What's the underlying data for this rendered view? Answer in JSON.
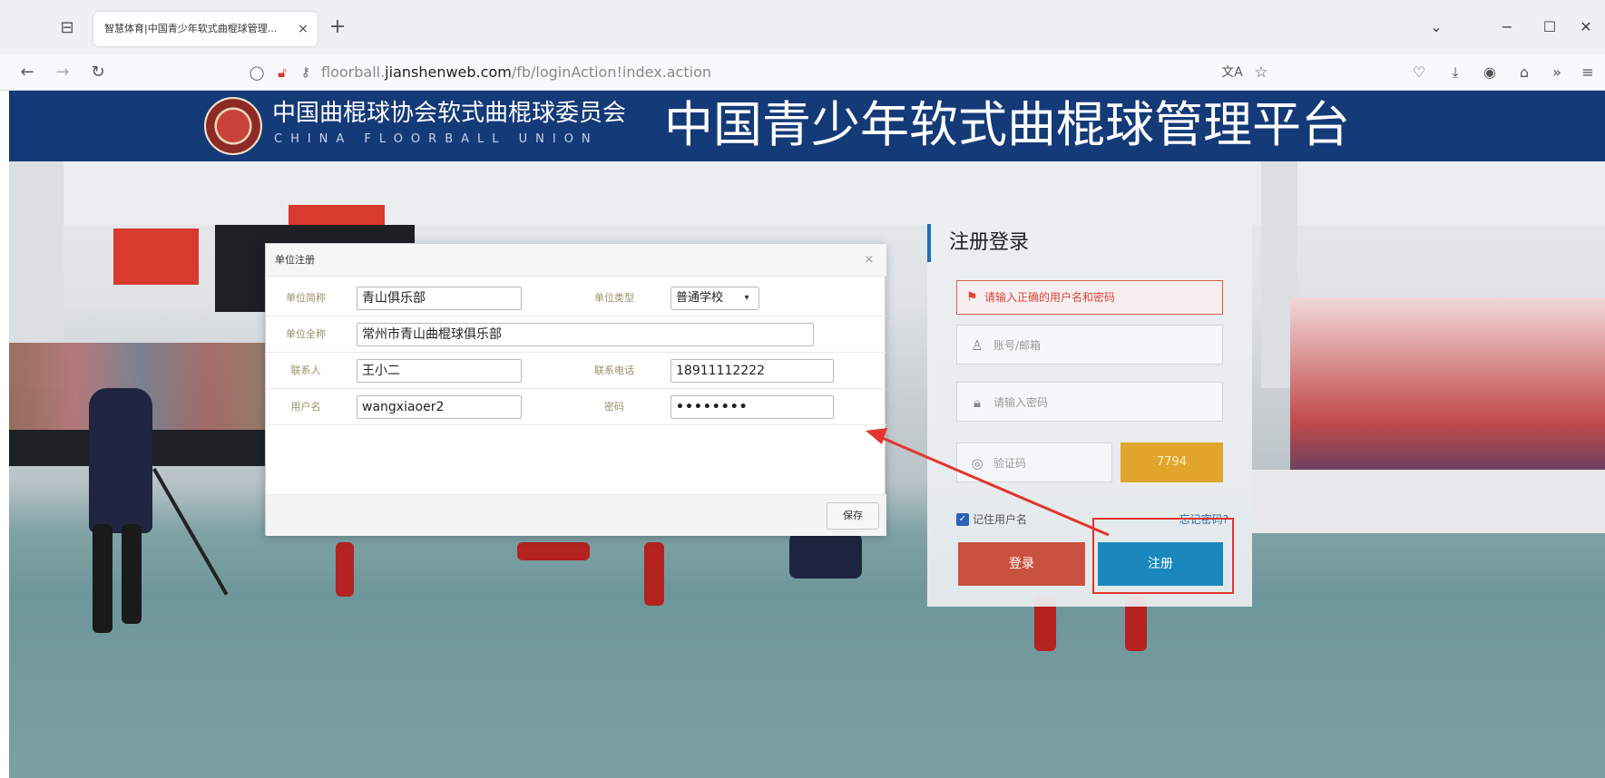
{
  "browser": {
    "tab_title": "智慧体育|中国青少年软式曲棍球管理...",
    "tab_close": "×",
    "new_tab": "+",
    "url_prefix": "floorball.",
    "url_domain": "jianshenweb.com",
    "url_path": "/fb/loginAction!index.action",
    "window_controls": {
      "dropdown": "⌄",
      "minimize": "−",
      "maximize": "☐",
      "close": "✕"
    },
    "nav": {
      "back": "←",
      "forward": "→",
      "reload": "↻"
    }
  },
  "banner": {
    "org_name": "中国曲棍球协会软式曲棍球委员会",
    "org_name_en": "CHINA FLOORBALL UNION",
    "platform_title": "中国青少年软式曲棍球管理平台"
  },
  "login": {
    "title": "注册登录",
    "error_message": "请输入正确的用户名和密码",
    "account_placeholder": "账号/邮箱",
    "password_placeholder": "请输入密码",
    "captcha_placeholder": "验证码",
    "captcha_code": "7794",
    "remember_label": "记住用户名",
    "forgot_link": "忘记密码?",
    "login_button": "登录",
    "register_button": "注册"
  },
  "dialog": {
    "title": "单位注册",
    "close": "×",
    "fields": {
      "short_name_label": "单位简称",
      "short_name_value": "青山俱乐部",
      "type_label": "单位类型",
      "type_value": "普通学校",
      "full_name_label": "单位全称",
      "full_name_value": "常州市青山曲棍球俱乐部",
      "contact_label": "联系人",
      "contact_value": "王小二",
      "phone_label": "联系电话",
      "phone_value": "18911112222",
      "username_label": "用户名",
      "username_value": "wangxiaoer2",
      "password_label": "密码",
      "password_value": "••••••••"
    },
    "save_button": "保存"
  },
  "colors": {
    "banner_bg": "#143a78",
    "login_button": "#c9523f",
    "register_button": "#1a88bc",
    "captcha_bg": "#e0a52a",
    "annotation_red": "#e2362c"
  }
}
